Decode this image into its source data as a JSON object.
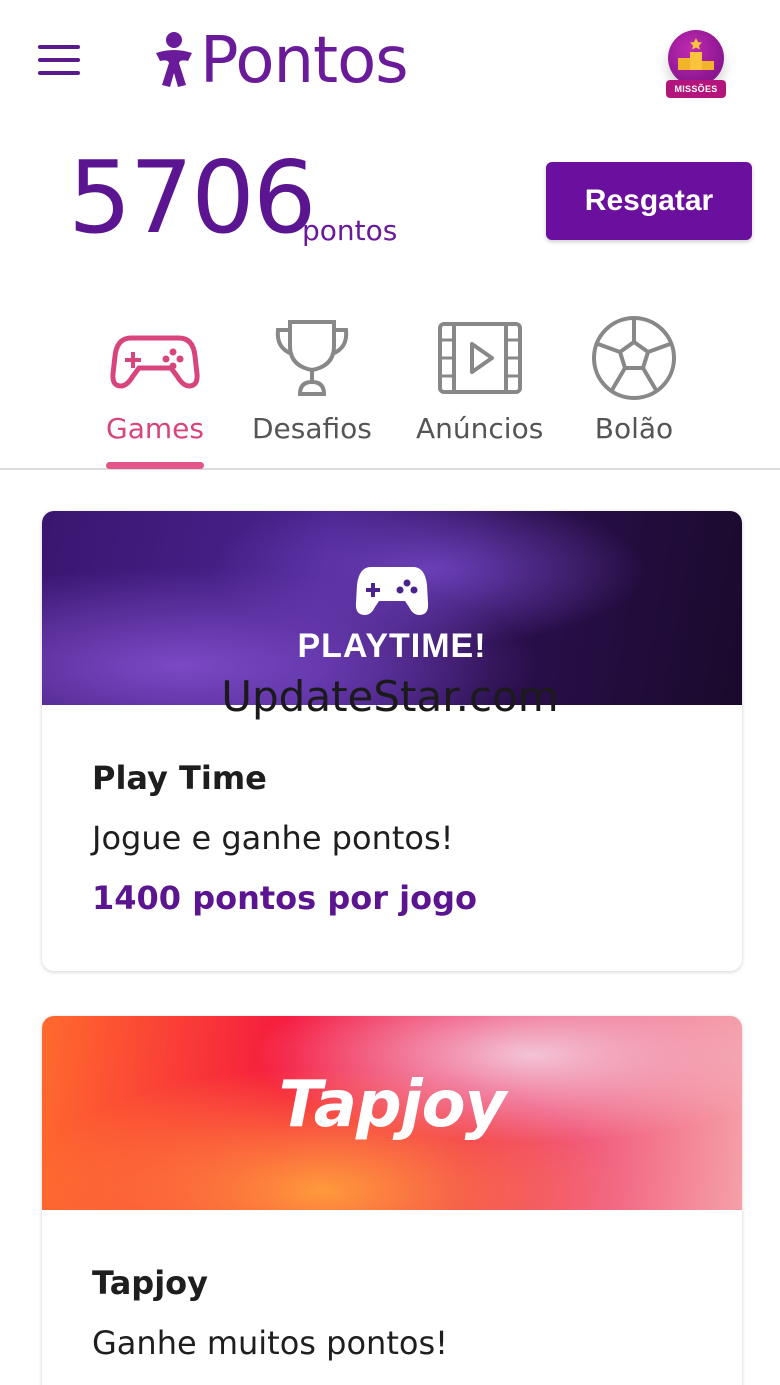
{
  "header": {
    "logo_text": "Pontos",
    "missions_label": "MISSÕES"
  },
  "points": {
    "value": "5706",
    "unit": "pontos",
    "redeem_label": "Resgatar"
  },
  "tabs": [
    {
      "label": "Games",
      "icon": "gamepad-icon",
      "active": true
    },
    {
      "label": "Desafios",
      "icon": "trophy-icon",
      "active": false
    },
    {
      "label": "Anúncios",
      "icon": "video-icon",
      "active": false
    },
    {
      "label": "Bolão",
      "icon": "soccer-ball-icon",
      "active": false
    }
  ],
  "cards": [
    {
      "banner_text": "PLAYTIME!",
      "title": "Play Time",
      "description": "Jogue e ganhe pontos!",
      "points_label": "1400 pontos por jogo"
    },
    {
      "banner_text": "Tapjoy",
      "title": "Tapjoy",
      "description": "Ganhe muitos pontos!"
    }
  ],
  "watermark": "UpdateStar.com",
  "colors": {
    "brand_purple": "#6a1b9a",
    "accent_pink": "#e2568a",
    "button_purple": "#6a0f9e"
  }
}
